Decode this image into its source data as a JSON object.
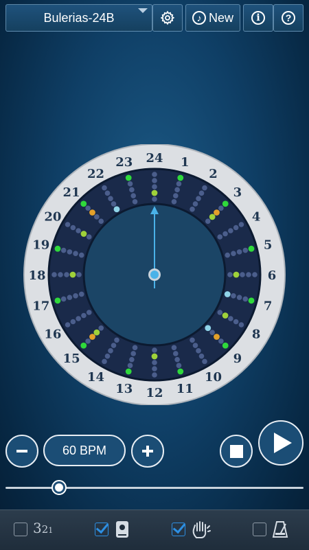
{
  "toolbar": {
    "preset_name": "Bulerias-24B",
    "new_label": "New",
    "settings_icon": "gear-icon",
    "new_icon": "music-note-icon",
    "info_icon": "info-icon",
    "help_icon": "help-icon"
  },
  "dial": {
    "beat_count": 24,
    "labels": [
      "1",
      "2",
      "3",
      "4",
      "5",
      "6",
      "7",
      "8",
      "9",
      "10",
      "11",
      "12",
      "13",
      "14",
      "15",
      "16",
      "17",
      "18",
      "19",
      "20",
      "21",
      "22",
      "23",
      "24"
    ],
    "current_beat": 24,
    "rings": [
      [
        "#2fd93b",
        "#4b5e8c",
        "#2fd93b",
        "#4b5e8c",
        "#2fd93b",
        "#4b5e8c",
        "#2fd93b",
        "#4b5e8c",
        "#2fd93b",
        "#4b5e8c",
        "#2fd93b",
        "#4b5e8c",
        "#2fd93b",
        "#4b5e8c",
        "#2fd93b",
        "#4b5e8c",
        "#2fd93b",
        "#4b5e8c",
        "#2fd93b",
        "#4b5e8c",
        "#2fd93b",
        "#4b5e8c",
        "#2fd93b",
        "#4b5e8c"
      ],
      [
        "#4b5e8c",
        "#4b5e8c",
        "#4b5e8c",
        "#4b5e8c",
        "#4b5e8c",
        "#4b5e8c",
        "#4b5e8c",
        "#4b5e8c",
        "#4b5e8c",
        "#4b5e8c",
        "#4b5e8c",
        "#4b5e8c",
        "#4b5e8c",
        "#4b5e8c",
        "#4b5e8c",
        "#4b5e8c",
        "#4b5e8c",
        "#4b5e8c",
        "#4b5e8c",
        "#4b5e8c",
        "#4b5e8c",
        "#4b5e8c",
        "#4b5e8c",
        "#4b5e8c"
      ],
      [
        "#4b5e8c",
        "#4b5e8c",
        "#e3a02a",
        "#4b5e8c",
        "#4b5e8c",
        "#4b5e8c",
        "#4b5e8c",
        "#4b5e8c",
        "#e3a02a",
        "#4b5e8c",
        "#4b5e8c",
        "#4b5e8c",
        "#4b5e8c",
        "#4b5e8c",
        "#e3a02a",
        "#4b5e8c",
        "#4b5e8c",
        "#4b5e8c",
        "#4b5e8c",
        "#4b5e8c",
        "#e3a02a",
        "#4b5e8c",
        "#4b5e8c",
        "#4b5e8c"
      ],
      [
        "#4b5e8c",
        "#4b5e8c",
        "#9fd23a",
        "#4b5e8c",
        "#4b5e8c",
        "#9fd23a",
        "#4b5e8c",
        "#9fd23a",
        "#4b5e8c",
        "#4b5e8c",
        "#4b5e8c",
        "#9fd23a",
        "#4b5e8c",
        "#4b5e8c",
        "#9fd23a",
        "#4b5e8c",
        "#4b5e8c",
        "#9fd23a",
        "#4b5e8c",
        "#9fd23a",
        "#4b5e8c",
        "#4b5e8c",
        "#4b5e8c",
        "#9fd23a"
      ],
      [
        "#4b5e8c",
        "#4b5e8c",
        "#4b5e8c",
        "#4b5e8c",
        "#4b5e8c",
        "#4b5e8c",
        "#8fd4e8",
        "#4b5e8c",
        "#8fd4e8",
        "#4b5e8c",
        "#4b5e8c",
        "#4b5e8c",
        "#4b5e8c",
        "#4b5e8c",
        "#4b5e8c",
        "#4b5e8c",
        "#4b5e8c",
        "#4b5e8c",
        "#4b5e8c",
        "#4b5e8c",
        "#4b5e8c",
        "#8fd4e8",
        "#4b5e8c",
        "#4b5e8c"
      ]
    ],
    "colors": {
      "outer_ring": "#dcdfe3",
      "track_bg": "#1a2a4a",
      "face": "#1b4566",
      "hand": "#4ab2e8",
      "label": "#1f3650"
    }
  },
  "tempo": {
    "bpm_label": "60 BPM",
    "minus_icon": "minus-icon",
    "plus_icon": "plus-icon"
  },
  "transport": {
    "stop_icon": "stop-icon",
    "play_icon": "play-icon"
  },
  "slider": {
    "value_fraction": 0.18
  },
  "bottom": {
    "countin": {
      "checked": false,
      "text_big": "3",
      "text_mid": "2",
      "text_small": "1"
    },
    "sound_box": {
      "checked": true,
      "icon": "cajon-icon"
    },
    "hand_clap": {
      "checked": true,
      "icon": "hand-clap-icon"
    },
    "metronome": {
      "checked": false,
      "icon": "metronome-icon"
    }
  }
}
